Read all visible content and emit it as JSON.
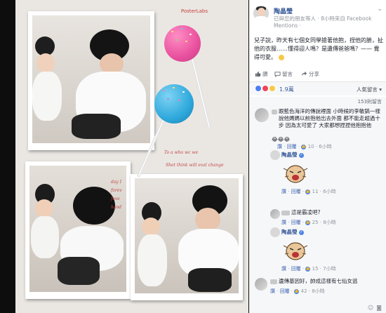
{
  "photo": {
    "brand": "PosterLabs",
    "script_lines": [
      "To a who wc we",
      "Shet think will eval change",
      "day I",
      "forev",
      "fove",
      "hand"
    ]
  },
  "post": {
    "author": "陶晶瑩",
    "meta": "已與您的朋友等人 · 8小時來自 Facebook Mentions ·",
    "text": "兒子說，昨天有七個女同學搶著他抱，捏他的臉，扯他的衣服……懂得迎人嗎？是遺傳爸爸嗎？——  覺得可愛。",
    "feeling_emoji": "smile-emoji",
    "actions": {
      "like": "讚",
      "comment": "留言",
      "share": "分享"
    },
    "reaction_count": "1.9萬",
    "sort_label": "人氣留言",
    "comments_count": "153則留言"
  },
  "comments": [
    {
      "name_hidden": true,
      "text": "跟藍色海洋的傳說裡面 小時候的李敏鎬一樣 說他媽媽以前抱他出去外面 都不能走超過十步 因為太可愛了 大家都想捏捏他抱抱他",
      "emoji_row": "😂😂😂",
      "like": "讚",
      "reply": "回覆",
      "count": "10",
      "time": "6小時"
    },
    {
      "name": "陶晶瑩",
      "sticker": "laughing-character-sticker",
      "like": "讚",
      "reply": "回覆",
      "count": "11",
      "time": "6小時"
    },
    {
      "name_hidden": true,
      "text": "這是霸凌吧?",
      "like": "讚",
      "reply": "回覆",
      "count": "25",
      "time": "8小時"
    },
    {
      "name": "陶晶瑩",
      "sticker": "laughing-character-sticker",
      "like": "讚",
      "reply": "回覆",
      "count": "15",
      "time": "7小時"
    },
    {
      "name_hidden": true,
      "text": "遺傳基因好，帥成這樣有七仙女逃",
      "like": "讚",
      "reply": "回覆",
      "count": "42",
      "time": "8小時"
    }
  ],
  "colors": {
    "link_blue": "#365899",
    "fb_blue": "#4267b2",
    "panel_bg": "#f6f7f9",
    "lolly_pink": "#e9519e",
    "lolly_blue": "#2fa9dc"
  }
}
